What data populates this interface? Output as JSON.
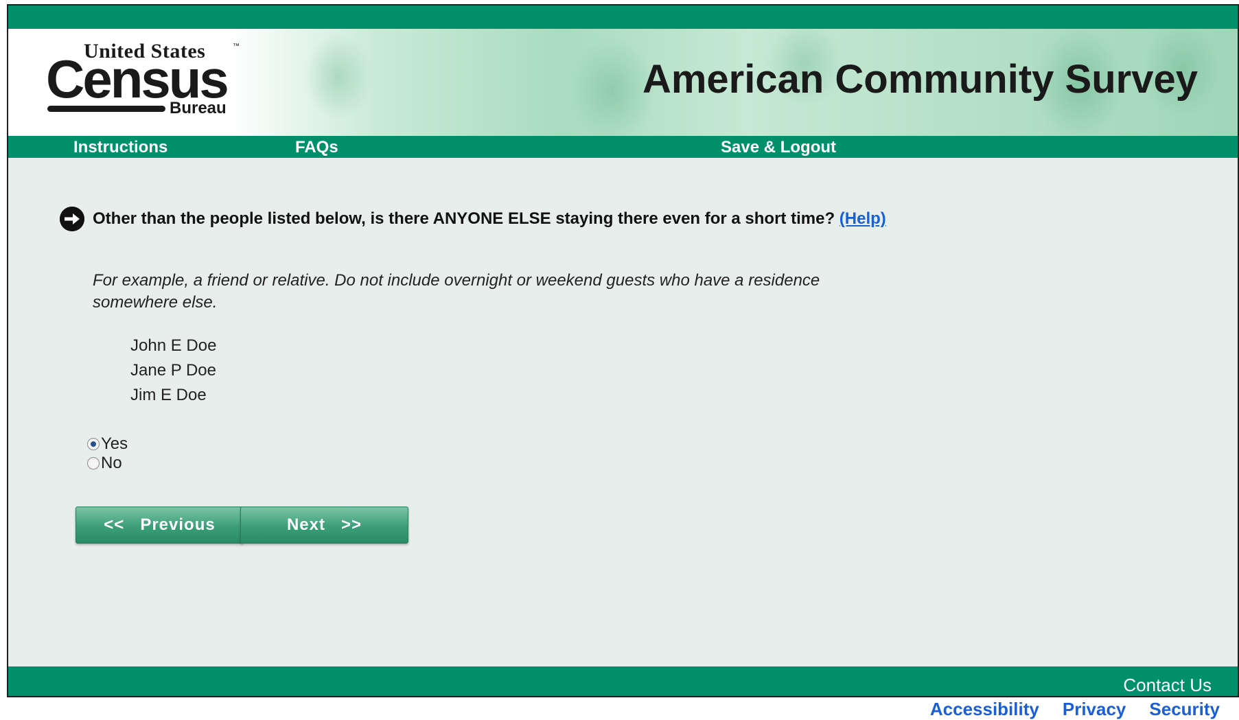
{
  "logo": {
    "top_text": "United States",
    "tm": "™",
    "main_text": "Census",
    "bureau_text": "Bureau"
  },
  "banner": {
    "title": "American Community Survey"
  },
  "nav": {
    "instructions": "Instructions",
    "faqs": "FAQs",
    "save_logout": "Save & Logout"
  },
  "question": {
    "text": "Other than the people listed below, is there ANYONE ELSE staying there even for a short time?",
    "help_label": "(Help)",
    "example": "For example, a friend or relative. Do not include overnight or weekend guests who have a residence somewhere else."
  },
  "people": [
    "John E Doe",
    "Jane P Doe",
    "Jim E Doe"
  ],
  "options": {
    "yes_label": "Yes",
    "no_label": "No",
    "selected": "Yes"
  },
  "buttons": {
    "previous": "<<   Previous",
    "next": "Next   >>"
  },
  "footer": {
    "contact": "Contact Us",
    "links": [
      "Accessibility",
      "Privacy",
      "Security"
    ]
  },
  "colors": {
    "brand_green": "#008f6b",
    "link_blue": "#1a5fd6",
    "content_bg": "#e8eeeb"
  }
}
